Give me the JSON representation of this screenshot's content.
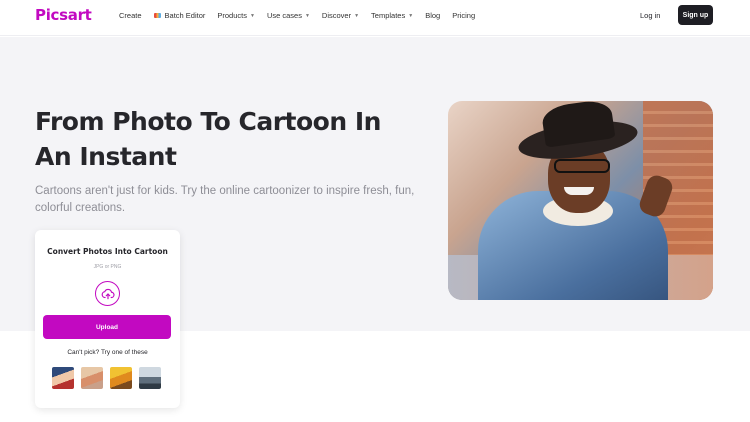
{
  "brand": {
    "logo": "Picsart",
    "accent": "#c209c1"
  },
  "nav": {
    "items": [
      {
        "label": "Create",
        "dropdown": false
      },
      {
        "label": "Batch Editor",
        "dropdown": false,
        "icon": "batch-editor-icon"
      },
      {
        "label": "Products",
        "dropdown": true
      },
      {
        "label": "Use cases",
        "dropdown": true
      },
      {
        "label": "Discover",
        "dropdown": true
      },
      {
        "label": "Templates",
        "dropdown": true
      },
      {
        "label": "Blog",
        "dropdown": false
      },
      {
        "label": "Pricing",
        "dropdown": false
      }
    ],
    "login": "Log in",
    "signup": "Sign up"
  },
  "hero": {
    "title": "From Photo To Cartoon In An Instant",
    "subtitle": "Cartoons aren't just for kids. Try the online cartoonizer to inspire fresh, fun, colorful creations."
  },
  "upload_card": {
    "title": "Convert Photos Into Cartoon",
    "formats": "JPG or PNG",
    "upload_label": "Upload",
    "try_text": "Can't pick? Try one of these",
    "samples": [
      "sample-photo-1",
      "sample-photo-2",
      "sample-photo-3",
      "sample-photo-4"
    ]
  }
}
